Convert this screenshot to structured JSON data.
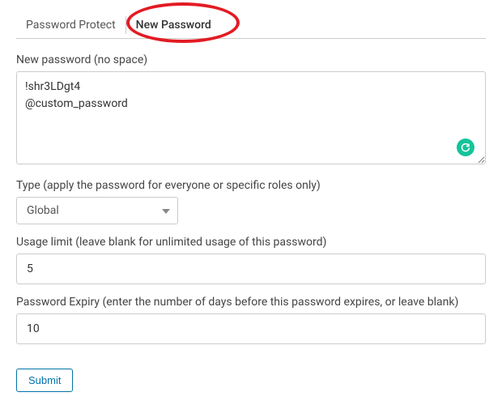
{
  "tabs": {
    "password_protect": "Password Protect",
    "new_password": "New Password"
  },
  "fields": {
    "new_password": {
      "label": "New password (no space)",
      "value": "!shr3LDgt4\n@custom_password"
    },
    "type": {
      "label": "Type (apply the password for everyone or specific roles only)",
      "selected": "Global"
    },
    "usage_limit": {
      "label": "Usage limit (leave blank for unlimited usage of this password)",
      "value": "5"
    },
    "password_expiry": {
      "label": "Password Expiry (enter the number of days before this password expires, or leave blank)",
      "value": "10"
    }
  },
  "submit_label": "Submit"
}
